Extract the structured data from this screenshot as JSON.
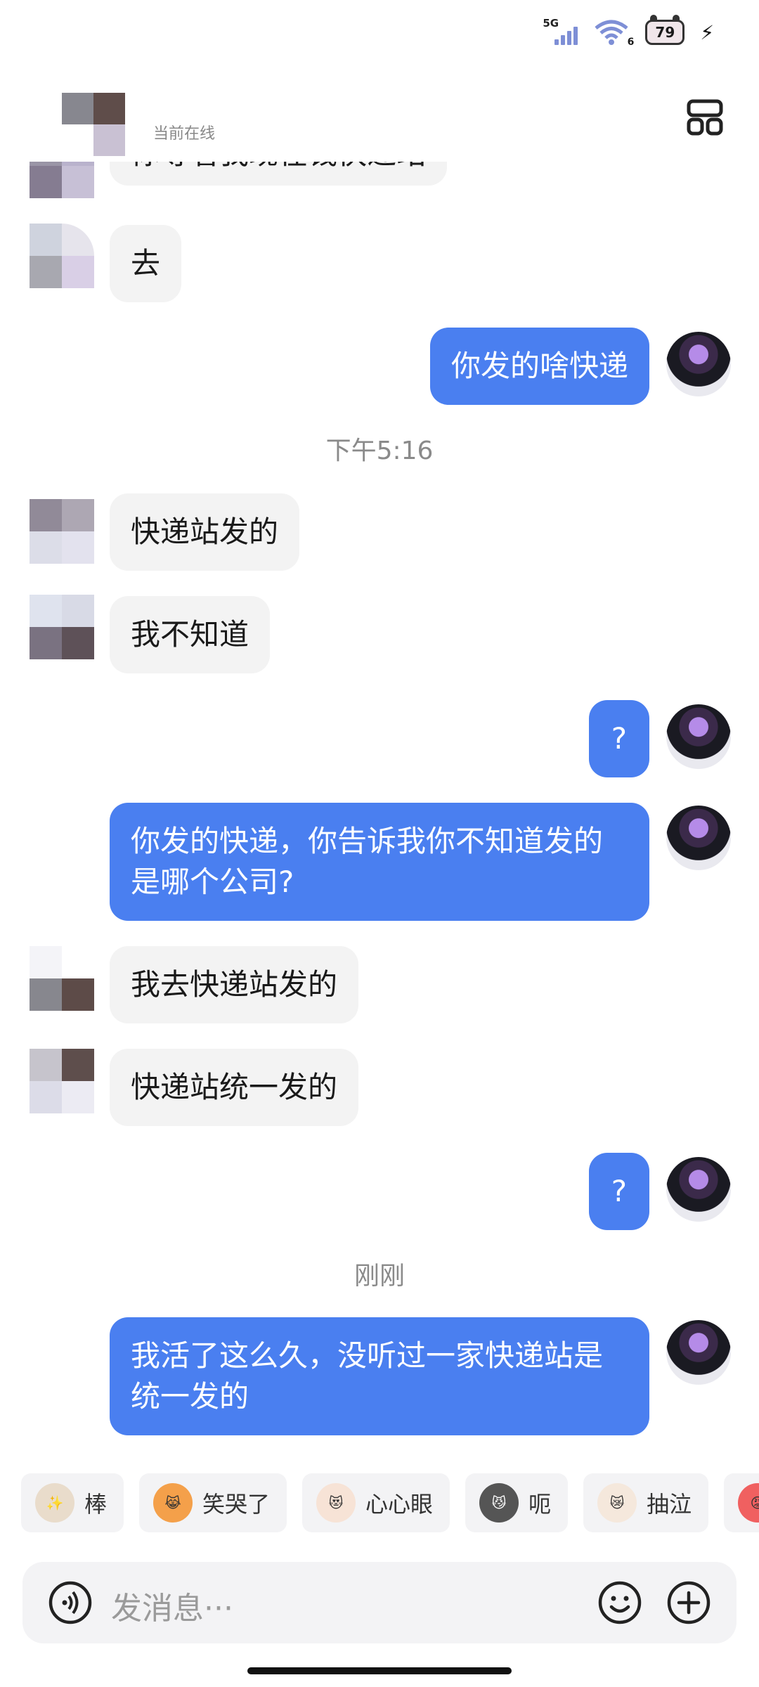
{
  "status_bar": {
    "network": "5G",
    "wifi_badge": "6",
    "battery": "79"
  },
  "header": {
    "status": "当前在线"
  },
  "messages": [
    {
      "side": "in",
      "text": "你等着我现在钱快递站"
    },
    {
      "side": "in",
      "text": "去"
    },
    {
      "side": "out",
      "text": "你发的啥快递"
    },
    {
      "time": "下午5:16"
    },
    {
      "side": "in",
      "text": "快递站发的"
    },
    {
      "side": "in",
      "text": "我不知道"
    },
    {
      "side": "out",
      "text": "?"
    },
    {
      "side": "out",
      "text": "你发的快递，你告诉我你不知道发的是哪个公司?"
    },
    {
      "side": "in",
      "text": "我去快递站发的"
    },
    {
      "side": "in",
      "text": "快递站统一发的"
    },
    {
      "side": "out",
      "text": "?"
    },
    {
      "time": "刚刚"
    },
    {
      "side": "out",
      "text": "我活了这么久，没听过一家快递站是统一发的"
    }
  ],
  "quick_replies": [
    {
      "label": "棒",
      "icon": "cat-sparkle-icon"
    },
    {
      "label": "笑哭了",
      "icon": "cat-laugh-cry-icon"
    },
    {
      "label": "心心眼",
      "icon": "cat-heart-eyes-icon"
    },
    {
      "label": "呃",
      "icon": "cat-awkward-icon"
    },
    {
      "label": "抽泣",
      "icon": "cat-sob-icon"
    }
  ],
  "input": {
    "placeholder": "发消息···"
  },
  "colors": {
    "outgoing_bubble": "#4a7ff0",
    "incoming_bubble": "#f3f3f3"
  }
}
